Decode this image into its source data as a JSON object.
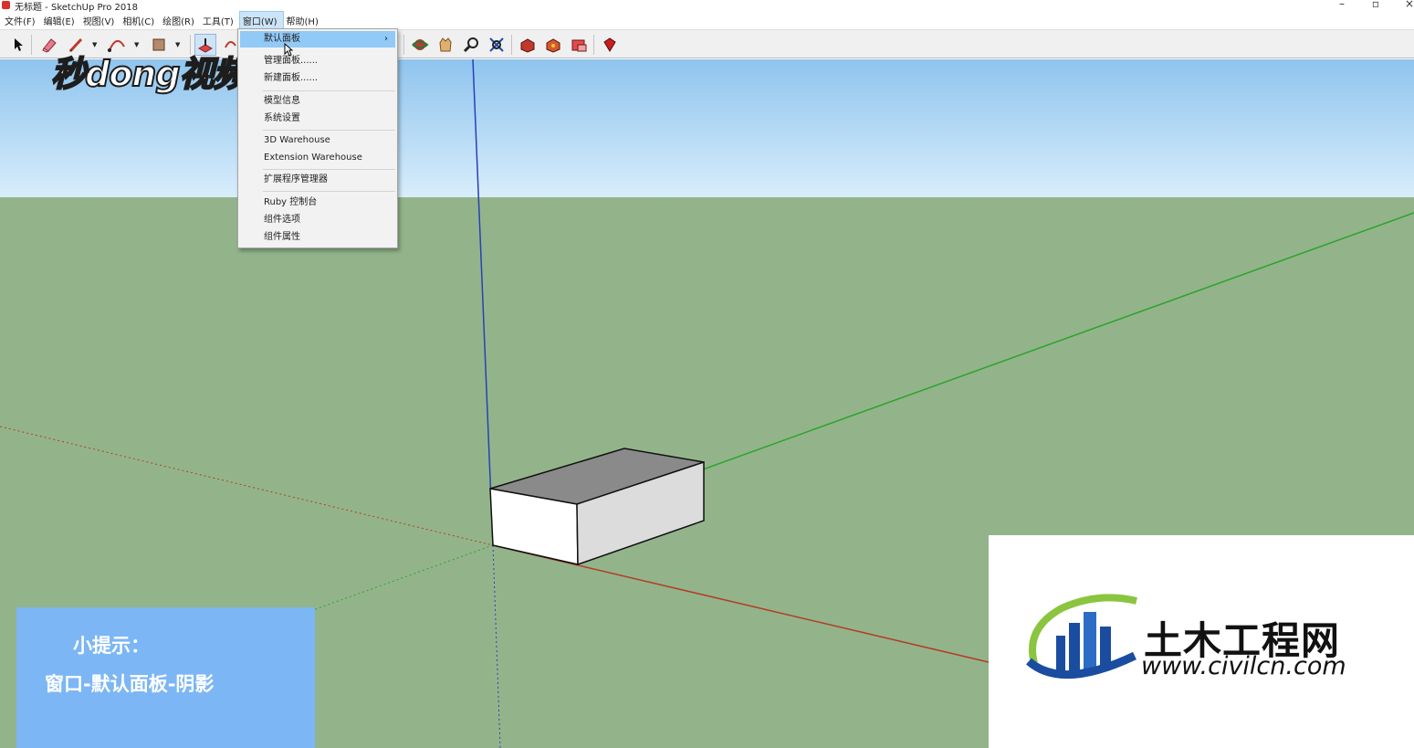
{
  "window": {
    "title": "无标题 - SketchUp Pro 2018",
    "minimize": "–",
    "restore": "▫",
    "close": "×"
  },
  "menubar": [
    {
      "label": "文件(F)"
    },
    {
      "label": "编辑(E)"
    },
    {
      "label": "视图(V)"
    },
    {
      "label": "相机(C)"
    },
    {
      "label": "绘图(R)"
    },
    {
      "label": "工具(T)"
    },
    {
      "label": "窗口(W)",
      "active": true
    },
    {
      "label": "帮助(H)"
    }
  ],
  "toolbar": {
    "icons": [
      "select-icon",
      "eraser-icon",
      "pencil-icon",
      "arc-icon",
      "rectangle-icon",
      "push-pull-icon",
      "rotate-icon",
      "orbit-icon",
      "pan-icon",
      "zoom-icon",
      "zoom-extents-icon",
      "warehouse-icon",
      "share-component-icon",
      "extension-icon",
      "ruby-icon"
    ]
  },
  "dropdown": {
    "items": [
      {
        "label": "默认面板",
        "submenu": true,
        "highlighted": true
      },
      {
        "label": "管理面板......"
      },
      {
        "label": "新建面板......"
      },
      {
        "label": "模型信息"
      },
      {
        "label": "系统设置"
      },
      {
        "label": "3D Warehouse"
      },
      {
        "label": "Extension Warehouse"
      },
      {
        "label": "扩展程序管理器"
      },
      {
        "label": "Ruby 控制台"
      },
      {
        "label": "组件选项"
      },
      {
        "label": "组件属性"
      }
    ],
    "submenu_arrow": "›"
  },
  "watermark": {
    "text": "秒dong视频"
  },
  "tip": {
    "title": "小提示：",
    "body": "窗口-默认面板-阴影"
  },
  "logo": {
    "name": "土木工程网",
    "url": "www.civilcn.com"
  },
  "colors": {
    "sky_top": "#8fc4ee",
    "ground": "#93b48a",
    "menu_highlight": "#91c9f7",
    "tip_box": "#7cb6f4",
    "axis_red": "#b43c28",
    "axis_green": "#2ca32c",
    "axis_blue": "#2a3fb8"
  }
}
